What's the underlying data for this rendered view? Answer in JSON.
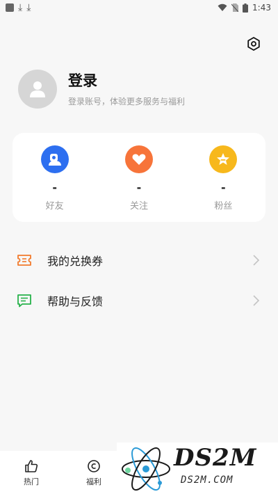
{
  "status_bar": {
    "time": "1:43"
  },
  "profile": {
    "title": "登录",
    "subtitle": "登录账号，体验更多服务与福利"
  },
  "stats": [
    {
      "value": "-",
      "label": "好友",
      "icon": "friends-icon",
      "color": "#2d6ff0"
    },
    {
      "value": "-",
      "label": "关注",
      "icon": "heart-icon",
      "color": "#f7743a"
    },
    {
      "value": "-",
      "label": "粉丝",
      "icon": "star-icon",
      "color": "#f7b81c"
    }
  ],
  "menu": [
    {
      "label": "我的兑换券",
      "icon": "ticket-icon",
      "color": "#f27a2c"
    },
    {
      "label": "帮助与反馈",
      "icon": "feedback-icon",
      "color": "#27b24a"
    }
  ],
  "tabs": [
    {
      "label": "热门",
      "icon": "thumbs-up-icon"
    },
    {
      "label": "福利",
      "icon": "coin-icon"
    }
  ],
  "watermark": {
    "text": "DS2M",
    "sub": "DS2M.COM"
  }
}
